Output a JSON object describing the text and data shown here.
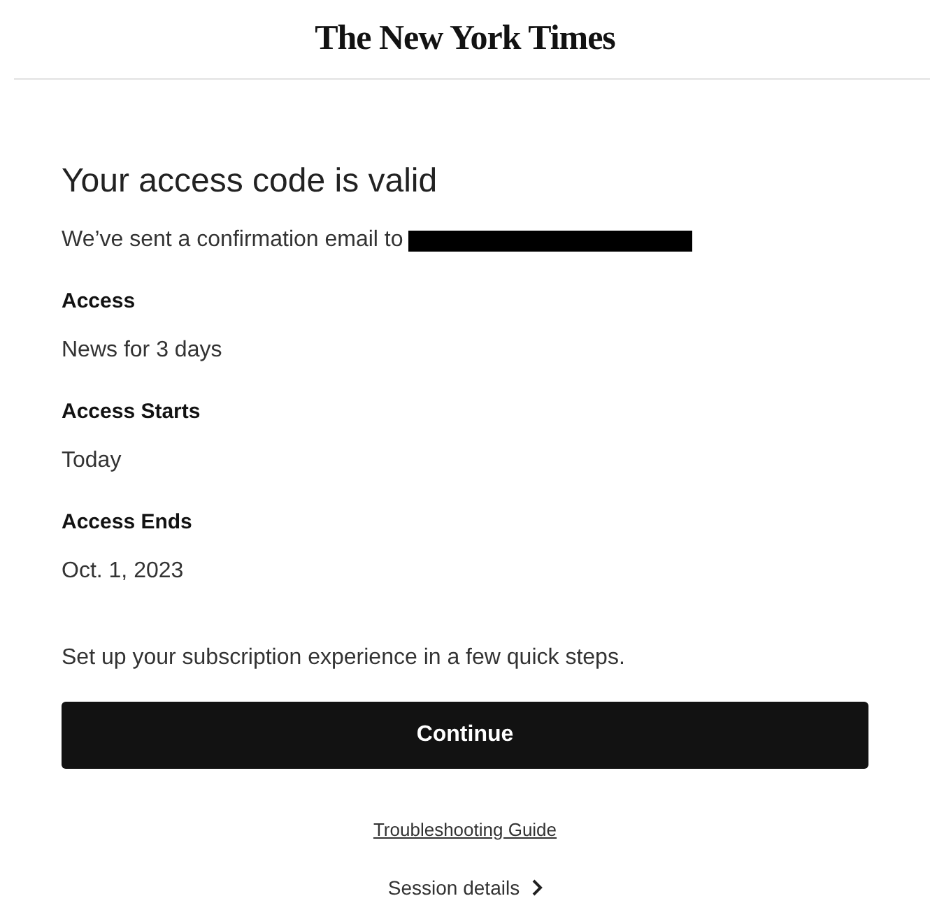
{
  "header": {
    "logo": "The New York Times"
  },
  "title": "Your access code is valid",
  "confirmation": {
    "text": "We’ve sent a confirmation email to",
    "email_redacted": true
  },
  "details": [
    {
      "label": "Access",
      "value": "News for 3 days"
    },
    {
      "label": "Access Starts",
      "value": "Today"
    },
    {
      "label": "Access Ends",
      "value": "Oct. 1, 2023"
    }
  ],
  "prompt": "Set up your subscription experience in a few quick steps.",
  "continue_button": "Continue",
  "troubleshooting_link": "Troubleshooting Guide",
  "session_details": "Session details"
}
